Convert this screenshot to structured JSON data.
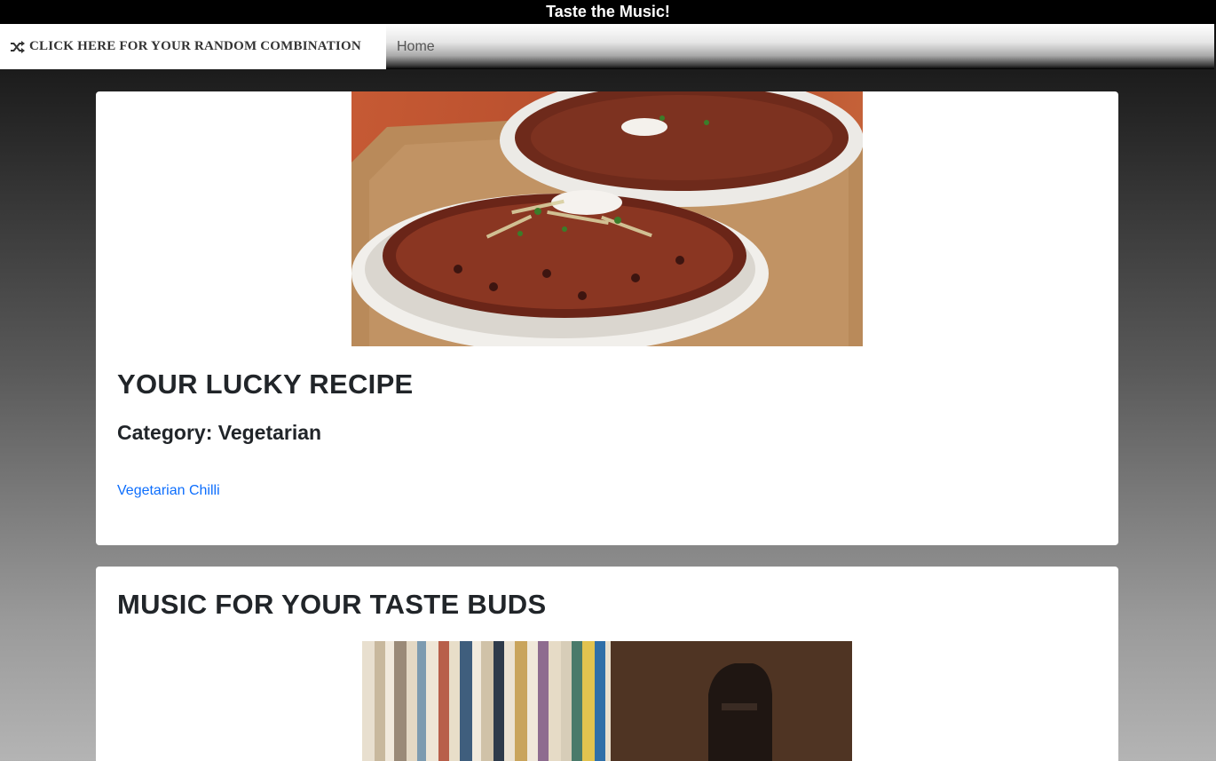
{
  "header": {
    "title": "Taste the Music!"
  },
  "nav": {
    "random_label": "CLICK HERE FOR YOUR RANDOM COMBINATION",
    "home_label": "Home"
  },
  "recipe_card": {
    "heading": "YOUR LUCKY RECIPE",
    "category": "Category: Vegetarian",
    "recipe_name": "Vegetarian Chilli"
  },
  "music_card": {
    "heading": "MUSIC FOR YOUR TASTE BUDS"
  },
  "colors": {
    "title_bar": "#000000",
    "link": "#0d6efd",
    "card": "#ffffff"
  }
}
